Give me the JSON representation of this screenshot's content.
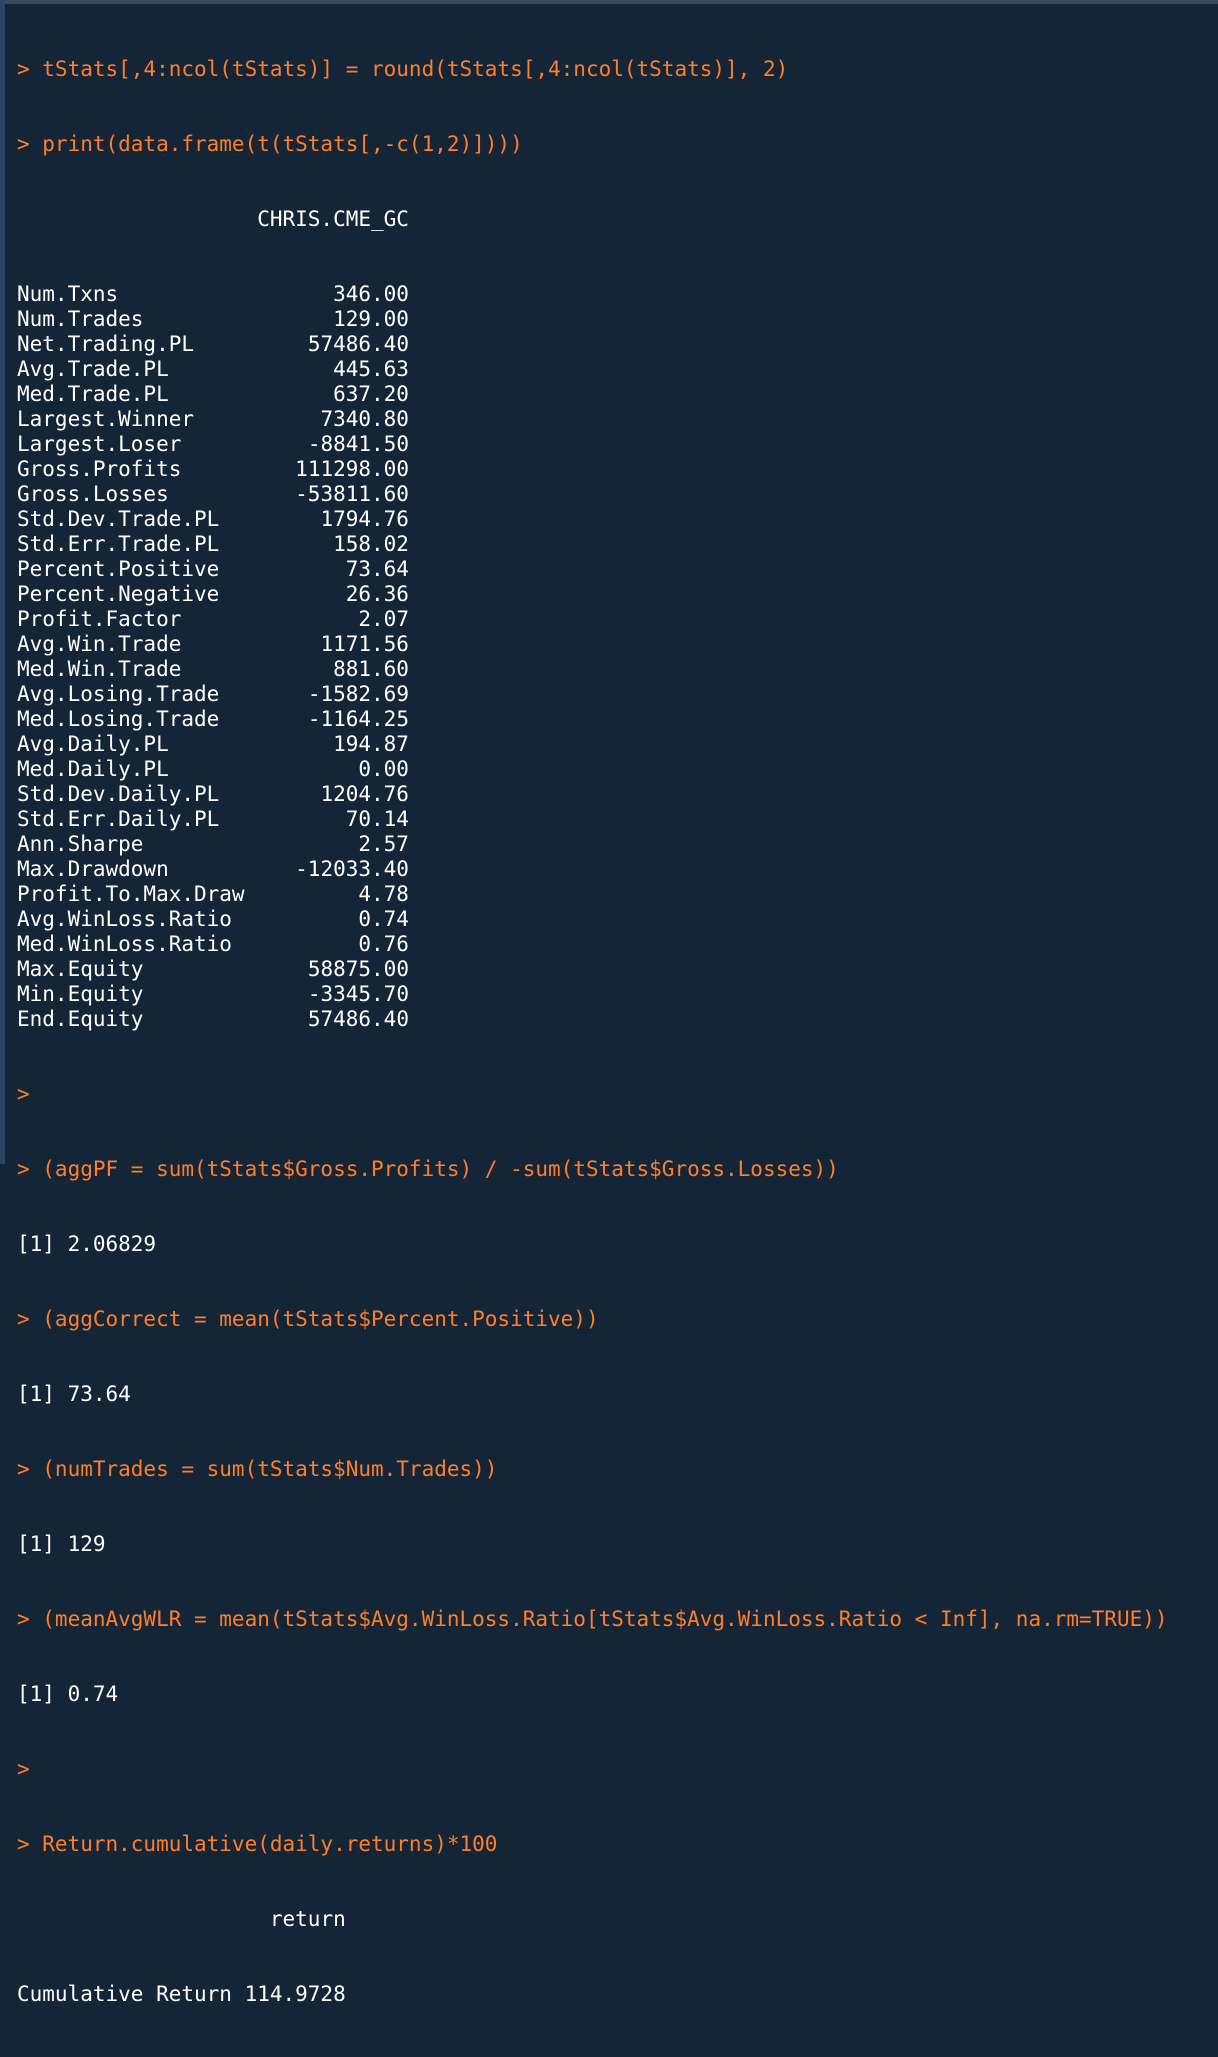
{
  "colors": {
    "background": "#142538",
    "command": "#ff7e29",
    "output": "#ffffff",
    "gutter": "#2b4562"
  },
  "commands": {
    "round_stats": "> tStats[,4:ncol(tStats)] = round(tStats[,4:ncol(tStats)], 2)",
    "print_frame": "> print(data.frame(t(tStats[,-c(1,2)])))",
    "blank_prompt_1": ">",
    "agg_pf": "> (aggPF = sum(tStats$Gross.Profits) / -sum(tStats$Gross.Losses))",
    "agg_correct": "> (aggCorrect = mean(tStats$Percent.Positive))",
    "num_trades": "> (numTrades = sum(tStats$Num.Trades))",
    "mean_avg_wlr": "> (meanAvgWLR = mean(tStats$Avg.WinLoss.Ratio[tStats$Avg.WinLoss.Ratio < Inf], na.rm=TRUE))",
    "blank_prompt_2": ">",
    "return_cumulative": "> Return.cumulative(daily.returns)*100"
  },
  "stats_table": {
    "column_header": "CHRIS.CME_GC",
    "rows": [
      {
        "label": "Num.Txns",
        "value": "346.00"
      },
      {
        "label": "Num.Trades",
        "value": "129.00"
      },
      {
        "label": "Net.Trading.PL",
        "value": "57486.40"
      },
      {
        "label": "Avg.Trade.PL",
        "value": "445.63"
      },
      {
        "label": "Med.Trade.PL",
        "value": "637.20"
      },
      {
        "label": "Largest.Winner",
        "value": "7340.80"
      },
      {
        "label": "Largest.Loser",
        "value": "-8841.50"
      },
      {
        "label": "Gross.Profits",
        "value": "111298.00"
      },
      {
        "label": "Gross.Losses",
        "value": "-53811.60"
      },
      {
        "label": "Std.Dev.Trade.PL",
        "value": "1794.76"
      },
      {
        "label": "Std.Err.Trade.PL",
        "value": "158.02"
      },
      {
        "label": "Percent.Positive",
        "value": "73.64"
      },
      {
        "label": "Percent.Negative",
        "value": "26.36"
      },
      {
        "label": "Profit.Factor",
        "value": "2.07"
      },
      {
        "label": "Avg.Win.Trade",
        "value": "1171.56"
      },
      {
        "label": "Med.Win.Trade",
        "value": "881.60"
      },
      {
        "label": "Avg.Losing.Trade",
        "value": "-1582.69"
      },
      {
        "label": "Med.Losing.Trade",
        "value": "-1164.25"
      },
      {
        "label": "Avg.Daily.PL",
        "value": "194.87"
      },
      {
        "label": "Med.Daily.PL",
        "value": "0.00"
      },
      {
        "label": "Std.Dev.Daily.PL",
        "value": "1204.76"
      },
      {
        "label": "Std.Err.Daily.PL",
        "value": "70.14"
      },
      {
        "label": "Ann.Sharpe",
        "value": "2.57"
      },
      {
        "label": "Max.Drawdown",
        "value": "-12033.40"
      },
      {
        "label": "Profit.To.Max.Draw",
        "value": "4.78"
      },
      {
        "label": "Avg.WinLoss.Ratio",
        "value": "0.74"
      },
      {
        "label": "Med.WinLoss.Ratio",
        "value": "0.76"
      },
      {
        "label": "Max.Equity",
        "value": "58875.00"
      },
      {
        "label": "Min.Equity",
        "value": "-3345.70"
      },
      {
        "label": "End.Equity",
        "value": "57486.40"
      }
    ]
  },
  "outputs": {
    "agg_pf": "[1] 2.06829",
    "agg_correct": "[1] 73.64",
    "num_trades": "[1] 129",
    "mean_avg_wlr": "[1] 0.74",
    "return_header": "return",
    "return_row": "Cumulative Return 114.9728"
  }
}
